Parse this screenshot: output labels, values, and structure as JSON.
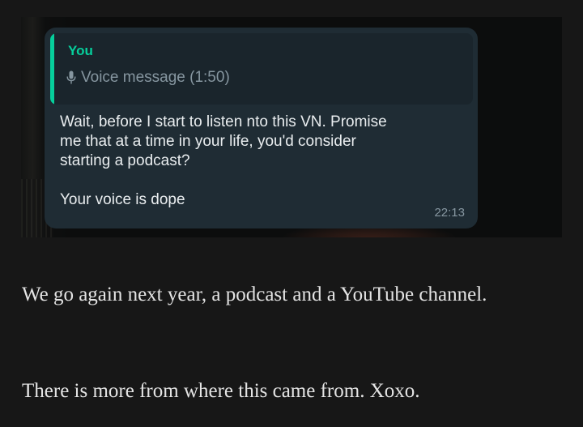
{
  "chat": {
    "quote_sender": "You",
    "quote_text": "Voice message (1:50)",
    "message_line1": "Wait, before I start to listen nto this VN. Promise",
    "message_line2": "me that at a time in your life, you'd consider",
    "message_line3": "starting a podcast?",
    "message_line4": "Your voice is dope",
    "time": "22:13",
    "accent_color": "#06cf9c",
    "bubble_color": "#1f2c34",
    "quote_icon": "mic-icon"
  },
  "article": {
    "paragraph1": "We go again next year, a podcast and a YouTube channel.",
    "paragraph2": "There is more from where this came from. Xoxo."
  }
}
